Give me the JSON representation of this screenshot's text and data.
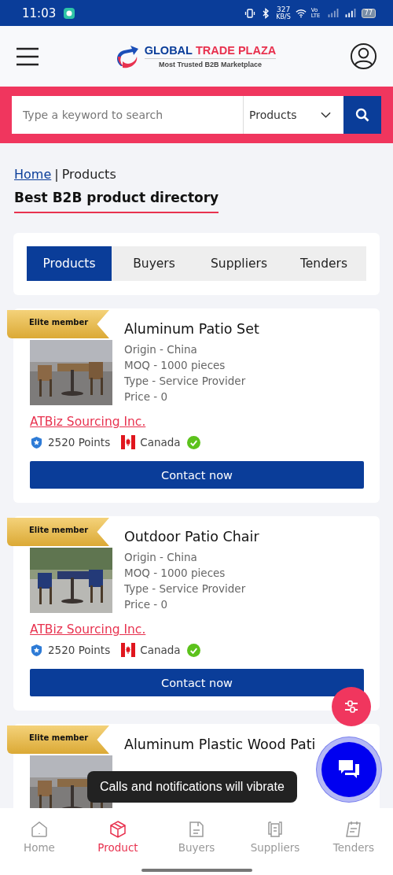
{
  "status_bar": {
    "time": "11:03",
    "speed": "327",
    "speed_unit": "KB/S",
    "network": "Vo LTE",
    "battery": "77"
  },
  "header": {
    "brand_first": "GLOBAL",
    "brand_second": "TRADE PLAZA",
    "tagline": "Most Trusted B2B Marketplace"
  },
  "search": {
    "placeholder": "Type a keyword to search",
    "category": "Products"
  },
  "breadcrumb": {
    "link": "Home",
    "separator": "|",
    "current": "Products"
  },
  "page_title": "Best B2B product directory",
  "tabs": [
    {
      "label": "Products",
      "selected": true
    },
    {
      "label": "Buyers",
      "selected": false
    },
    {
      "label": "Suppliers",
      "selected": false
    },
    {
      "label": "Tenders",
      "selected": false
    }
  ],
  "products": [
    {
      "badge": "Elite member",
      "title": "Aluminum Patio Set",
      "details": [
        "Origin - China",
        "MOQ - 1000 pieces",
        "Type - Service Provider",
        "Price - 0"
      ],
      "seller": "ATBiz Sourcing Inc.",
      "points": "2520 Points",
      "country": "Canada",
      "verified": true,
      "button": "Contact now"
    },
    {
      "badge": "Elite member",
      "title": "Outdoor Patio Chair",
      "details": [
        "Origin - China",
        "MOQ - 1000 pieces",
        "Type - Service Provider",
        "Price - 0"
      ],
      "seller": "ATBiz Sourcing Inc.",
      "points": "2520 Points",
      "country": "Canada",
      "verified": true,
      "button": "Contact now"
    },
    {
      "badge": "Elite member",
      "title": "Aluminum Plastic Wood Pati"
    }
  ],
  "toast": "Calls and notifications will vibrate",
  "bottom_nav": [
    {
      "label": "Home",
      "selected": false
    },
    {
      "label": "Product",
      "selected": true
    },
    {
      "label": "Buyers",
      "selected": false
    },
    {
      "label": "Suppliers",
      "selected": false
    },
    {
      "label": "Tenders",
      "selected": false
    }
  ]
}
